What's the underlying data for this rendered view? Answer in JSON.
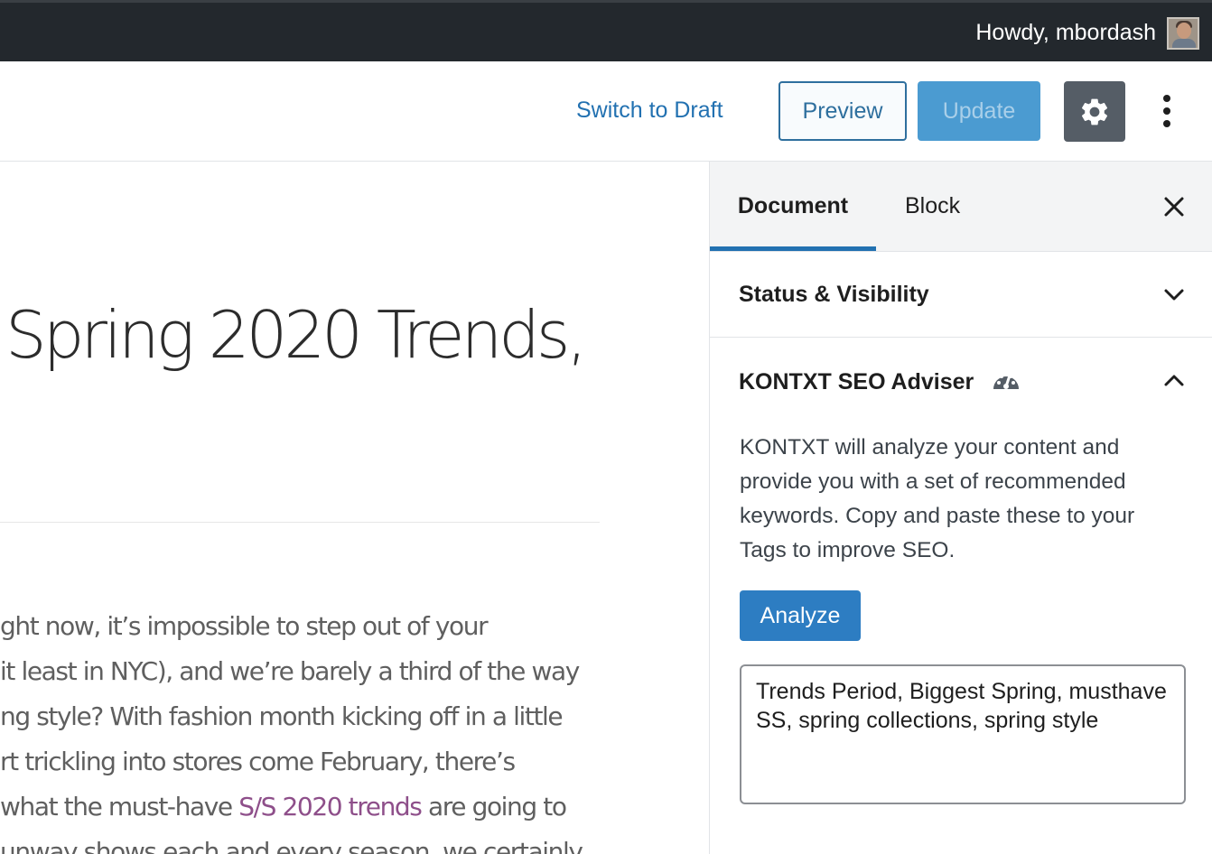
{
  "admin_bar": {
    "greeting": "Howdy, mbordash"
  },
  "header": {
    "switch_to_draft": "Switch to Draft",
    "preview": "Preview",
    "update": "Update"
  },
  "editor": {
    "title": "Spring 2020 Trends,",
    "body_lines": [
      "ght now, it’s impossible to step out of your",
      "it least in NYC), and we’re barely a third of the way",
      "ng style? With fashion month kicking off in a little",
      "rt trickling into stores come February, there’s",
      "what the must-have ",
      "unway shows each and every season, we certainly"
    ],
    "link_text": "S/S 2020 trends",
    "after_link": " are going to"
  },
  "sidebar": {
    "tabs": [
      {
        "label": "Document",
        "active": true
      },
      {
        "label": "Block",
        "active": false
      }
    ],
    "status_panel": {
      "title": "Status & Visibility",
      "expanded": false
    },
    "seo_panel": {
      "title": "KONTXT SEO Adviser",
      "expanded": true,
      "description": "KONTXT will analyze your content and provide you with a set of recommended keywords. Copy and paste these to your Tags to improve SEO.",
      "analyze_label": "Analyze",
      "keywords": "Trends Period, Biggest Spring, musthave SS, spring collections, spring style"
    }
  },
  "colors": {
    "admin_bar": "#23282d",
    "accent": "#2271b1",
    "update_button": "#4b9bd1",
    "link": "#8e4f8a"
  }
}
